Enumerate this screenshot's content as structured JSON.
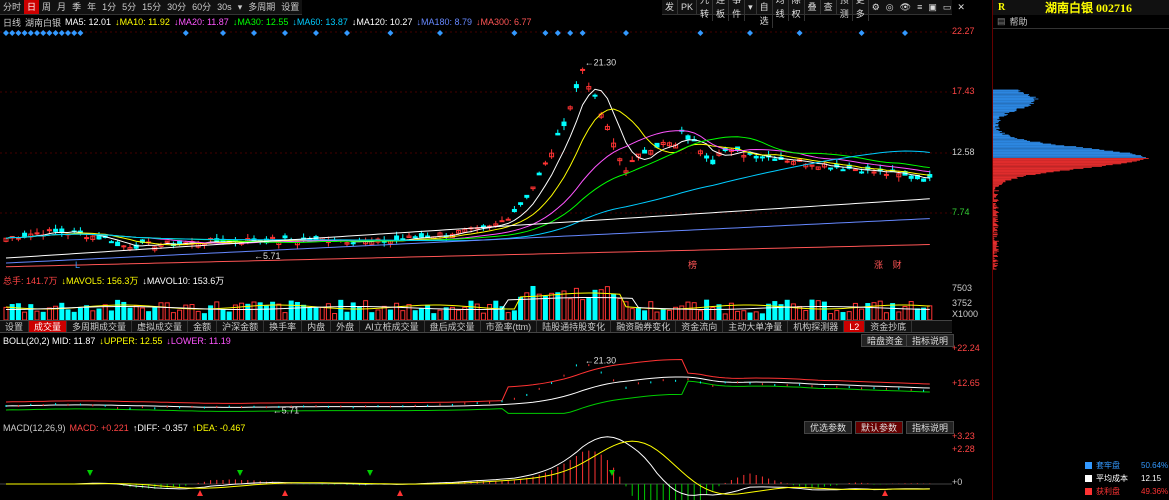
{
  "toolbar": {
    "tabs": [
      "分时",
      "日",
      "周",
      "月",
      "季",
      "年",
      "1分",
      "5分",
      "15分",
      "30分",
      "60分",
      "30s",
      "▾",
      "多周期",
      "设置"
    ],
    "selected": "日"
  },
  "right_toolbar": [
    "发",
    "PK",
    "九转",
    "连板",
    "事件",
    "▾",
    "删自选",
    "均线",
    "除权",
    "叠",
    "查",
    "预测",
    "更多"
  ],
  "window_icons": [
    "⚙",
    "◎",
    "👁",
    "≡",
    "▣",
    "▭",
    "✕"
  ],
  "stock": {
    "symbol": "R",
    "title": "湖南白银 002716",
    "help": "帮助",
    "line_type": "日线",
    "name": "湖南白银"
  },
  "ma_legend": [
    {
      "text": "MA5: 12.01",
      "color": "#ffffff"
    },
    {
      "text": "↓MA10: 11.92",
      "color": "#ffff00"
    },
    {
      "text": "↓MA20: 11.87",
      "color": "#ff55ff"
    },
    {
      "text": "↓MA30: 12.55",
      "color": "#00ff00"
    },
    {
      "text": "↓MA60: 13.87",
      "color": "#00ccff"
    },
    {
      "text": "↓MA120: 10.27",
      "color": "#ffffff"
    },
    {
      "text": "↓MA180: 8.79",
      "color": "#6688ff"
    },
    {
      "text": "↓MA300: 6.77",
      "color": "#ff5555"
    }
  ],
  "price_axis": [
    "22.27",
    "17.43",
    "12.58",
    "7.74"
  ],
  "annotations": {
    "high": "21.30",
    "low": "5.71"
  },
  "main_labels": {
    "left_marker": "L",
    "mid_marker": "榜",
    "right_markers": [
      "涨",
      "财"
    ]
  },
  "vol_legend": [
    {
      "text": "总手: 141.7万",
      "color": "#ff4444"
    },
    {
      "text": "↓MAVOL5: 156.3万",
      "color": "#ffff00"
    },
    {
      "text": "↓MAVOL10: 153.6万",
      "color": "#ffffff"
    }
  ],
  "vol_axis": [
    "7503",
    "3752",
    "X1000"
  ],
  "indicator_tabs": [
    "设置",
    "成交量",
    "多周期成交量",
    "虚拟成交量",
    "金额",
    "沪深金额",
    "换手率",
    "内盘",
    "外盘",
    "AI立桩成交量",
    "盘后成交量",
    "市盈率(ttm)",
    "陆股通持股变化",
    "融资融券变化",
    "资金流向",
    "主动大单净量",
    "机构探测器",
    "资金抄底"
  ],
  "indicator_selected": "成交量",
  "indicator_badge": "L2",
  "boll_legend": [
    {
      "text": "BOLL(20,2) MID: 11.87",
      "color": "#ffffff"
    },
    {
      "text": "↓UPPER: 12.55",
      "color": "#ffff00"
    },
    {
      "text": "↓LOWER: 11.19",
      "color": "#ff55ff"
    }
  ],
  "boll_buttons": [
    "暗盘资金",
    "指标说明"
  ],
  "boll_axis": [
    "+22.24",
    "+12.65"
  ],
  "boll_annotations": {
    "high": "21.30",
    "low": "5.71"
  },
  "macd_legend": [
    {
      "text": "MACD(12,26,9)",
      "color": "#cccccc"
    },
    {
      "text": "MACD: +0.221",
      "color": "#ff4444"
    },
    {
      "text": "↑DIFF: -0.357",
      "color": "#ffffff"
    },
    {
      "text": "↑DEA: -0.467",
      "color": "#ffff00"
    }
  ],
  "macd_buttons": [
    "优选参数",
    "默认参数",
    "指标说明"
  ],
  "macd_axis": [
    "+3.23",
    "+2.28",
    "+0"
  ],
  "chip_stats": [
    {
      "label": "套牢盘",
      "value": "50.64%",
      "color": "#3399ff"
    },
    {
      "label": "平均成本",
      "value": "12.15",
      "color": "#ffffff"
    },
    {
      "label": "获利盘",
      "value": "49.36%",
      "color": "#ff3333"
    }
  ]
}
